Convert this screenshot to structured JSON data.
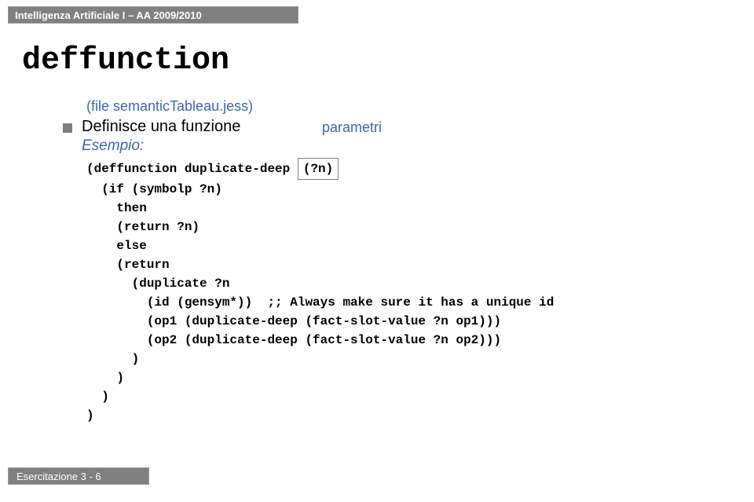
{
  "header": "Intelligenza Artificiale I – AA 2009/2010",
  "title": "deffunction",
  "fileLine": "(file semanticTableau.jess)",
  "bulletText": "Definisce una funzione",
  "esempio": "Esempio:",
  "parametri": "parametri",
  "code": {
    "l1a": "(deffunction duplicate-deep ",
    "l1b": "(?n)",
    "l2": "  (if (symbolp ?n)",
    "l3": "    then",
    "l4": "    (return ?n)",
    "l5": "    else",
    "l6": "    (return",
    "l7": "      (duplicate ?n",
    "l8": "        (id (gensym*))  ;; Always make sure it has a unique id",
    "l9": "        (op1 (duplicate-deep (fact-slot-value ?n op1)))",
    "l10": "        (op2 (duplicate-deep (fact-slot-value ?n op2)))",
    "l11": "      )",
    "l12": "    )",
    "l13": "  )",
    "l14": ")"
  },
  "footer": "Esercitazione 3 - 6"
}
